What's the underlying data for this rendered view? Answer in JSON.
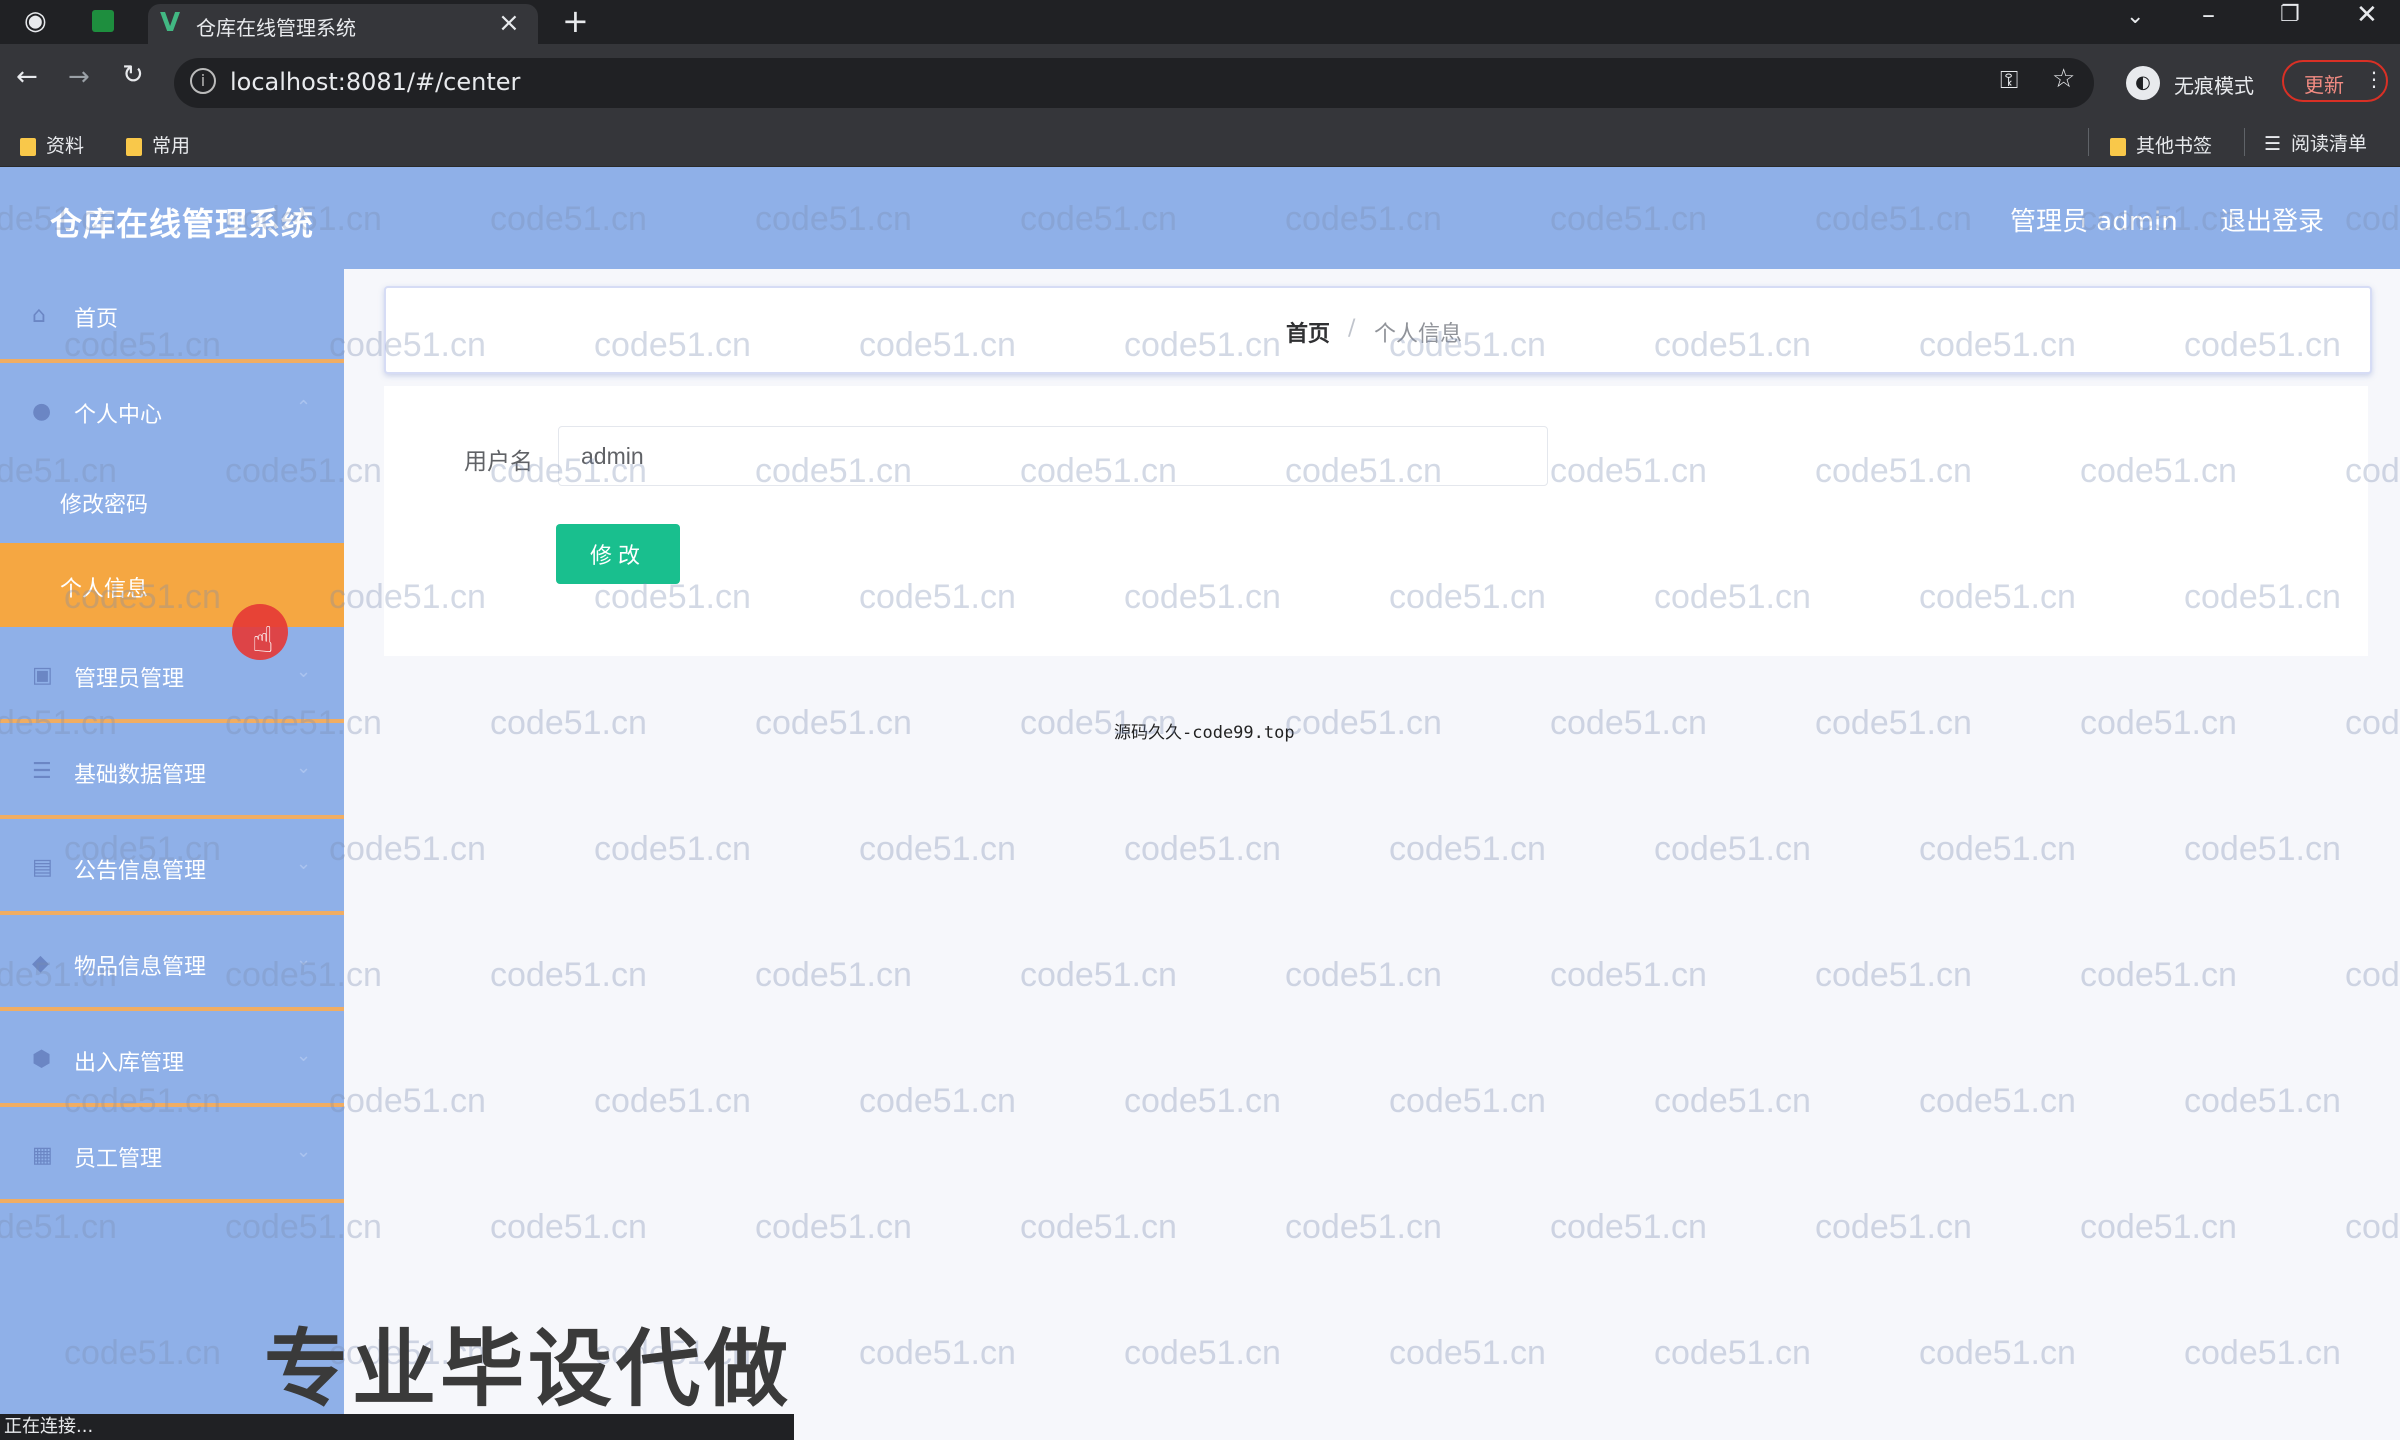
{
  "browser": {
    "tab_title": "仓库在线管理系统",
    "url": "localhost:8081/#/center",
    "incognito_label": "无痕模式",
    "update_label": "更新",
    "bookmarks": [
      "资料",
      "常用"
    ],
    "other_bookmarks": "其他书签",
    "reading_list": "阅读清单",
    "status_text": "正在连接..."
  },
  "header": {
    "title": "仓库在线管理系统",
    "user_label": "管理员 admin",
    "logout_label": "退出登录"
  },
  "sidebar": {
    "items": [
      {
        "label": "首页",
        "icon": "home-icon"
      },
      {
        "label": "个人中心",
        "icon": "user-icon"
      },
      {
        "label": "管理员管理",
        "icon": "admin-icon"
      },
      {
        "label": "基础数据管理",
        "icon": "list-icon"
      },
      {
        "label": "公告信息管理",
        "icon": "notice-icon"
      },
      {
        "label": "物品信息管理",
        "icon": "goods-icon"
      },
      {
        "label": "出入库管理",
        "icon": "inout-icon"
      },
      {
        "label": "员工管理",
        "icon": "staff-icon"
      }
    ],
    "sub_items": [
      "修改密码",
      "个人信息"
    ]
  },
  "breadcrumb": {
    "home": "首页",
    "separator": "/",
    "current": "个人信息"
  },
  "form": {
    "username_label": "用户名",
    "username_value": "admin",
    "submit_label": "修改"
  },
  "footer_note": "源码久久-code99.top",
  "watermark": "code51.cn",
  "promo_text": "专业毕设代做"
}
